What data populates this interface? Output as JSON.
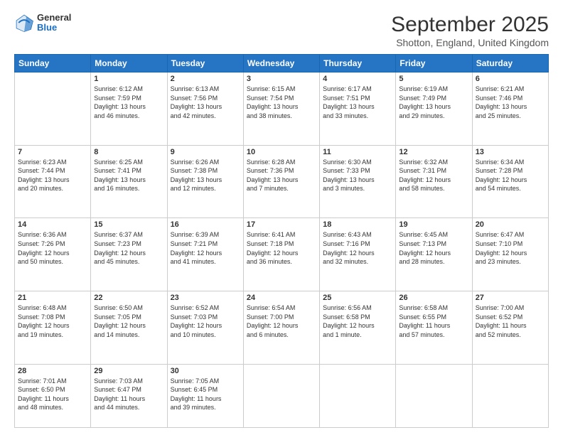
{
  "header": {
    "logo_general": "General",
    "logo_blue": "Blue",
    "month_title": "September 2025",
    "subtitle": "Shotton, England, United Kingdom"
  },
  "days_of_week": [
    "Sunday",
    "Monday",
    "Tuesday",
    "Wednesday",
    "Thursday",
    "Friday",
    "Saturday"
  ],
  "weeks": [
    [
      {
        "day": "",
        "info": ""
      },
      {
        "day": "1",
        "info": "Sunrise: 6:12 AM\nSunset: 7:59 PM\nDaylight: 13 hours\nand 46 minutes."
      },
      {
        "day": "2",
        "info": "Sunrise: 6:13 AM\nSunset: 7:56 PM\nDaylight: 13 hours\nand 42 minutes."
      },
      {
        "day": "3",
        "info": "Sunrise: 6:15 AM\nSunset: 7:54 PM\nDaylight: 13 hours\nand 38 minutes."
      },
      {
        "day": "4",
        "info": "Sunrise: 6:17 AM\nSunset: 7:51 PM\nDaylight: 13 hours\nand 33 minutes."
      },
      {
        "day": "5",
        "info": "Sunrise: 6:19 AM\nSunset: 7:49 PM\nDaylight: 13 hours\nand 29 minutes."
      },
      {
        "day": "6",
        "info": "Sunrise: 6:21 AM\nSunset: 7:46 PM\nDaylight: 13 hours\nand 25 minutes."
      }
    ],
    [
      {
        "day": "7",
        "info": "Sunrise: 6:23 AM\nSunset: 7:44 PM\nDaylight: 13 hours\nand 20 minutes."
      },
      {
        "day": "8",
        "info": "Sunrise: 6:25 AM\nSunset: 7:41 PM\nDaylight: 13 hours\nand 16 minutes."
      },
      {
        "day": "9",
        "info": "Sunrise: 6:26 AM\nSunset: 7:38 PM\nDaylight: 13 hours\nand 12 minutes."
      },
      {
        "day": "10",
        "info": "Sunrise: 6:28 AM\nSunset: 7:36 PM\nDaylight: 13 hours\nand 7 minutes."
      },
      {
        "day": "11",
        "info": "Sunrise: 6:30 AM\nSunset: 7:33 PM\nDaylight: 13 hours\nand 3 minutes."
      },
      {
        "day": "12",
        "info": "Sunrise: 6:32 AM\nSunset: 7:31 PM\nDaylight: 12 hours\nand 58 minutes."
      },
      {
        "day": "13",
        "info": "Sunrise: 6:34 AM\nSunset: 7:28 PM\nDaylight: 12 hours\nand 54 minutes."
      }
    ],
    [
      {
        "day": "14",
        "info": "Sunrise: 6:36 AM\nSunset: 7:26 PM\nDaylight: 12 hours\nand 50 minutes."
      },
      {
        "day": "15",
        "info": "Sunrise: 6:37 AM\nSunset: 7:23 PM\nDaylight: 12 hours\nand 45 minutes."
      },
      {
        "day": "16",
        "info": "Sunrise: 6:39 AM\nSunset: 7:21 PM\nDaylight: 12 hours\nand 41 minutes."
      },
      {
        "day": "17",
        "info": "Sunrise: 6:41 AM\nSunset: 7:18 PM\nDaylight: 12 hours\nand 36 minutes."
      },
      {
        "day": "18",
        "info": "Sunrise: 6:43 AM\nSunset: 7:16 PM\nDaylight: 12 hours\nand 32 minutes."
      },
      {
        "day": "19",
        "info": "Sunrise: 6:45 AM\nSunset: 7:13 PM\nDaylight: 12 hours\nand 28 minutes."
      },
      {
        "day": "20",
        "info": "Sunrise: 6:47 AM\nSunset: 7:10 PM\nDaylight: 12 hours\nand 23 minutes."
      }
    ],
    [
      {
        "day": "21",
        "info": "Sunrise: 6:48 AM\nSunset: 7:08 PM\nDaylight: 12 hours\nand 19 minutes."
      },
      {
        "day": "22",
        "info": "Sunrise: 6:50 AM\nSunset: 7:05 PM\nDaylight: 12 hours\nand 14 minutes."
      },
      {
        "day": "23",
        "info": "Sunrise: 6:52 AM\nSunset: 7:03 PM\nDaylight: 12 hours\nand 10 minutes."
      },
      {
        "day": "24",
        "info": "Sunrise: 6:54 AM\nSunset: 7:00 PM\nDaylight: 12 hours\nand 6 minutes."
      },
      {
        "day": "25",
        "info": "Sunrise: 6:56 AM\nSunset: 6:58 PM\nDaylight: 12 hours\nand 1 minute."
      },
      {
        "day": "26",
        "info": "Sunrise: 6:58 AM\nSunset: 6:55 PM\nDaylight: 11 hours\nand 57 minutes."
      },
      {
        "day": "27",
        "info": "Sunrise: 7:00 AM\nSunset: 6:52 PM\nDaylight: 11 hours\nand 52 minutes."
      }
    ],
    [
      {
        "day": "28",
        "info": "Sunrise: 7:01 AM\nSunset: 6:50 PM\nDaylight: 11 hours\nand 48 minutes."
      },
      {
        "day": "29",
        "info": "Sunrise: 7:03 AM\nSunset: 6:47 PM\nDaylight: 11 hours\nand 44 minutes."
      },
      {
        "day": "30",
        "info": "Sunrise: 7:05 AM\nSunset: 6:45 PM\nDaylight: 11 hours\nand 39 minutes."
      },
      {
        "day": "",
        "info": ""
      },
      {
        "day": "",
        "info": ""
      },
      {
        "day": "",
        "info": ""
      },
      {
        "day": "",
        "info": ""
      }
    ]
  ]
}
